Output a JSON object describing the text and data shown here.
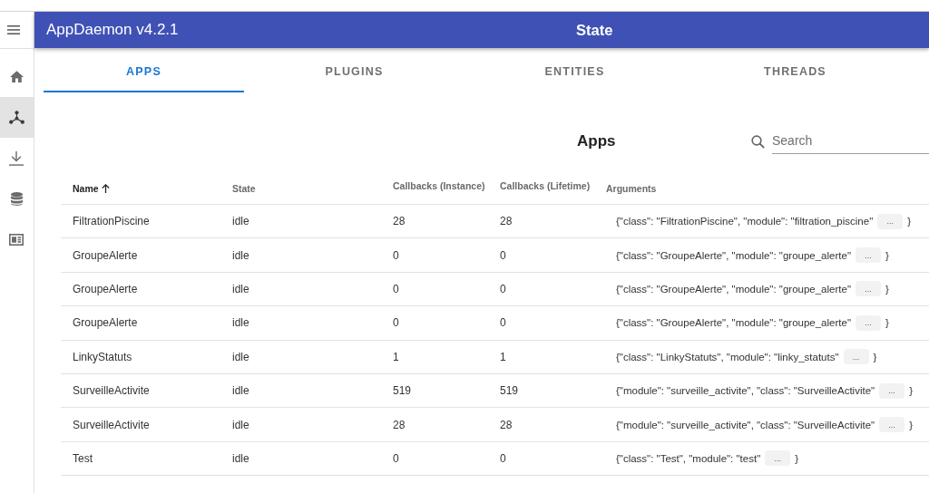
{
  "sidebar": {
    "items": [
      {
        "kind": "home",
        "selected": false
      },
      {
        "kind": "apps",
        "selected": true
      },
      {
        "kind": "download",
        "selected": false
      },
      {
        "kind": "database",
        "selected": false
      },
      {
        "kind": "logs",
        "selected": false
      }
    ]
  },
  "app_bar": {
    "title": "AppDaemon v4.2.1",
    "page": "State"
  },
  "tabs": [
    {
      "label": "APPS",
      "selected": true
    },
    {
      "label": "PLUGINS",
      "selected": false
    },
    {
      "label": "ENTITIES",
      "selected": false
    },
    {
      "label": "THREADS",
      "selected": false
    }
  ],
  "section": {
    "title": "Apps",
    "search": {
      "placeholder": "Search"
    }
  },
  "table": {
    "columns": [
      {
        "label": "Name",
        "sorted": true
      },
      {
        "label": "State",
        "sorted": false
      },
      {
        "label": "Callbacks (Instance)",
        "sorted": false
      },
      {
        "label": "Callbacks (Lifetime)",
        "sorted": false
      },
      {
        "label": "Arguments",
        "sorted": false
      }
    ],
    "rows": [
      {
        "name": "FiltrationPiscine",
        "state": "idle",
        "callbacks_instance": "28",
        "callbacks_lifetime": "28",
        "arguments": {
          "text": "{\"class\": \"FiltrationPiscine\", \"module\": \"filtration_piscine\"",
          "more": "...",
          "close": "}"
        }
      },
      {
        "name": "GroupeAlerte",
        "state": "idle",
        "callbacks_instance": "0",
        "callbacks_lifetime": "0",
        "arguments": {
          "text": "{\"class\": \"GroupeAlerte\", \"module\": \"groupe_alerte\"",
          "more": "...",
          "close": "}"
        }
      },
      {
        "name": "GroupeAlerte",
        "state": "idle",
        "callbacks_instance": "0",
        "callbacks_lifetime": "0",
        "arguments": {
          "text": "{\"class\": \"GroupeAlerte\", \"module\": \"groupe_alerte\"",
          "more": "...",
          "close": "}"
        }
      },
      {
        "name": "GroupeAlerte",
        "state": "idle",
        "callbacks_instance": "0",
        "callbacks_lifetime": "0",
        "arguments": {
          "text": "{\"class\": \"GroupeAlerte\", \"module\": \"groupe_alerte\"",
          "more": "...",
          "close": "}"
        }
      },
      {
        "name": "LinkyStatuts",
        "state": "idle",
        "callbacks_instance": "1",
        "callbacks_lifetime": "1",
        "arguments": {
          "text": "{\"class\": \"LinkyStatuts\", \"module\": \"linky_statuts\"",
          "more": "...",
          "close": "}"
        }
      },
      {
        "name": "SurveilleActivite",
        "state": "idle",
        "callbacks_instance": "519",
        "callbacks_lifetime": "519",
        "arguments": {
          "text": "{\"module\": \"surveille_activite\", \"class\": \"SurveilleActivite\"",
          "more": "...",
          "close": "}"
        }
      },
      {
        "name": "SurveilleActivite",
        "state": "idle",
        "callbacks_instance": "28",
        "callbacks_lifetime": "28",
        "arguments": {
          "text": "{\"module\": \"surveille_activite\", \"class\": \"SurveilleActivite\"",
          "more": "...",
          "close": "}"
        }
      },
      {
        "name": "Test",
        "state": "idle",
        "callbacks_instance": "0",
        "callbacks_lifetime": "0",
        "arguments": {
          "text": "{\"class\": \"Test\", \"module\": \"test\"",
          "more": "...",
          "close": "}"
        }
      }
    ]
  }
}
